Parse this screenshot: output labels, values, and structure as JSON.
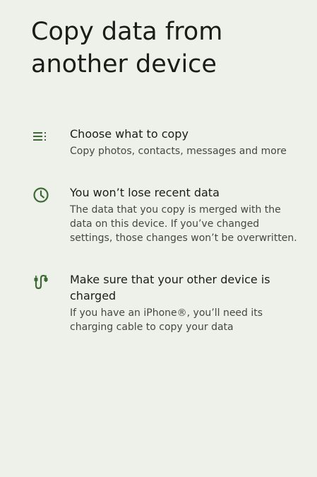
{
  "header": {
    "title": "Copy data from another device"
  },
  "items": [
    {
      "icon": "checklist-icon",
      "title": "Choose what to copy",
      "description": "Copy photos, contacts, messages and more"
    },
    {
      "icon": "clock-icon",
      "title": "You won’t lose recent data",
      "description": "The data that you copy is merged with the data on this device. If you’ve changed settings, those changes won’t be overwritten."
    },
    {
      "icon": "cable-icon",
      "title": "Make sure that your other device is charged",
      "description": "If you have an iPhone®, you’ll need its charging cable to copy your data"
    }
  ],
  "colors": {
    "background": "#eef1ea",
    "icon": "#3d6a35",
    "text_primary": "#1b1c18",
    "text_secondary": "#45483f"
  }
}
